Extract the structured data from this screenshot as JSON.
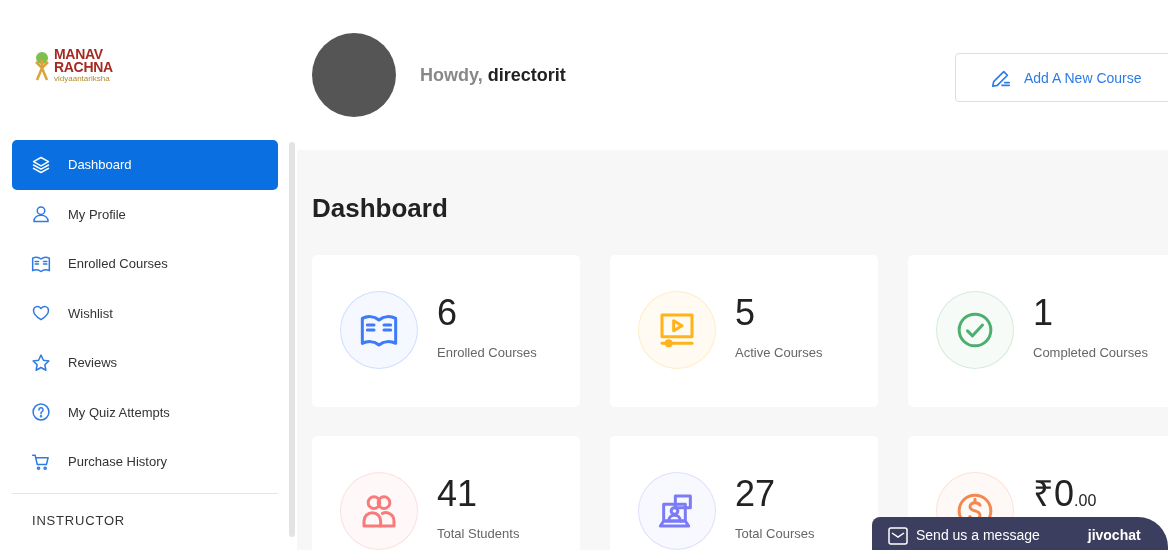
{
  "logo": {
    "line_1": "MANAV",
    "line_2": "RACHNA",
    "tagline": "vidyaantariksha"
  },
  "sidebar": {
    "items": [
      {
        "label": "Dashboard",
        "selected": true
      },
      {
        "label": "My Profile",
        "selected": false
      },
      {
        "label": "Enrolled Courses",
        "selected": false
      },
      {
        "label": "Wishlist",
        "selected": false
      },
      {
        "label": "Reviews",
        "selected": false
      },
      {
        "label": "My Quiz Attempts",
        "selected": false
      },
      {
        "label": "Purchase History",
        "selected": false
      }
    ],
    "section_heading": "INSTRUCTOR"
  },
  "header": {
    "greeting": "Howdy,",
    "username": "directorit",
    "button": "Add A New Course"
  },
  "page_title": "Dashboard",
  "stats": [
    {
      "value": "6",
      "label": "Enrolled Courses",
      "color": "#3e7bfa"
    },
    {
      "value": "5",
      "label": "Active Courses",
      "color": "#ffb21a"
    },
    {
      "value": "1",
      "label": "Completed Courses",
      "color": "#4caf6e"
    },
    {
      "value": "41",
      "label": "Total Students",
      "color": "#f77b7b"
    },
    {
      "value": "27",
      "label": "Total Courses",
      "color": "#7b7bf7"
    },
    {
      "value": "₹0",
      "fraction": ".00",
      "color": "#f5884f"
    }
  ],
  "chat": {
    "label": "Send us a message",
    "brand": "jivochat"
  }
}
